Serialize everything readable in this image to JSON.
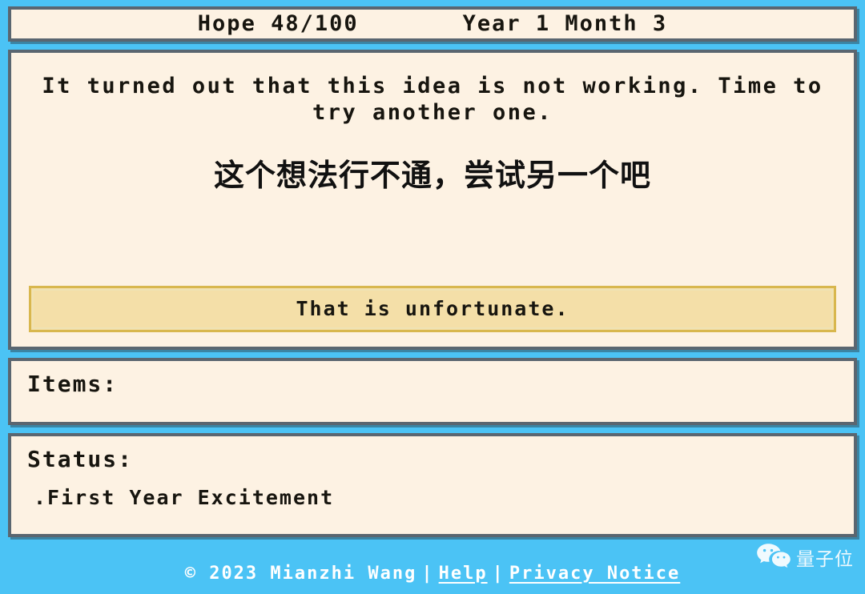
{
  "statusbar": {
    "hope_label": "Hope",
    "hope_value": "48/100",
    "hope_text": "Hope 48/100",
    "date_text": "Year 1 Month 3",
    "year_label": "Year",
    "year_value": "1",
    "month_label": "Month",
    "month_value": "3"
  },
  "message": {
    "english": "It turned out that this idea is not working. Time to try another one.",
    "chinese": "这个想法行不通，尝试另一个吧"
  },
  "choices": [
    {
      "label": "That is unfortunate."
    }
  ],
  "items": {
    "title": "Items:",
    "entries": []
  },
  "status": {
    "title": "Status:",
    "entries": [
      {
        "bullet": ".",
        "label": "First Year Excitement",
        "text": ".First Year Excitement"
      }
    ]
  },
  "footer": {
    "copyright": "© 2023 Mianzhi Wang",
    "separator": "|",
    "help_label": "Help",
    "privacy_label": "Privacy Notice"
  },
  "watermark": {
    "icon": "wechat-icon",
    "text": "量子位"
  },
  "colors": {
    "background": "#4bc3f5",
    "panel_fill": "#fdf2e3",
    "panel_border": "#5a6670",
    "choice_fill": "#f4dfa8",
    "choice_border": "#d8b74e",
    "text": "#17150f",
    "footer_text": "#ffffff"
  }
}
